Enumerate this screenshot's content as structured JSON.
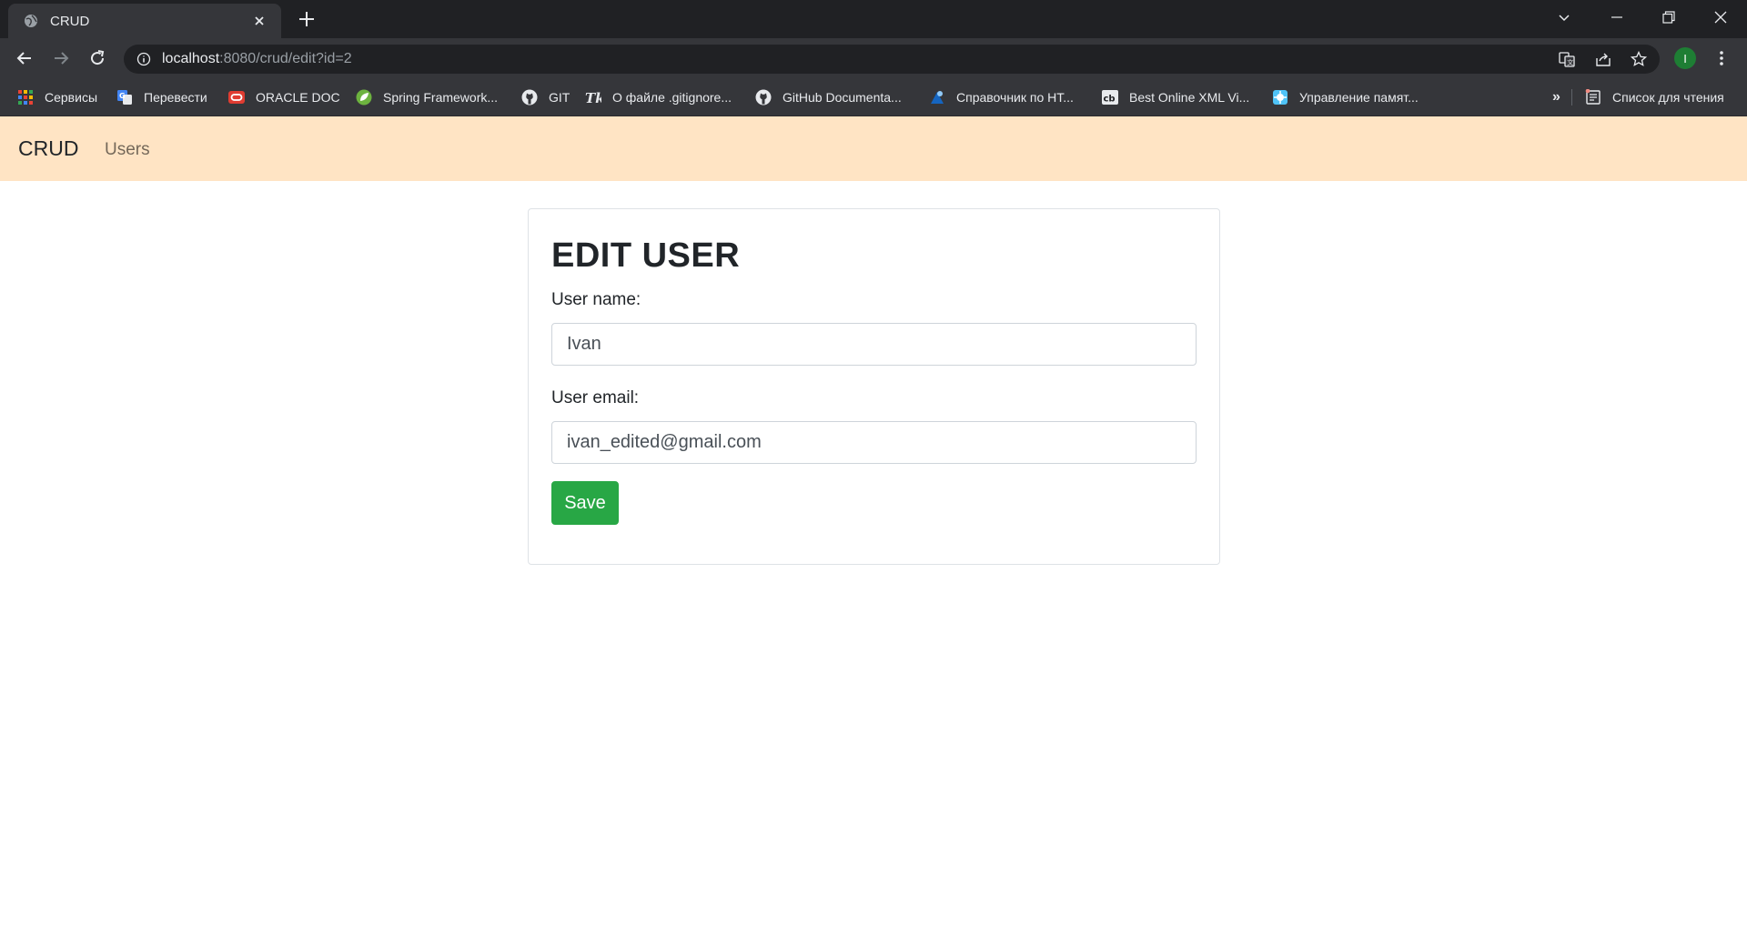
{
  "browser": {
    "tab_title": "CRUD",
    "url_host": "localhost",
    "url_rest": ":8080/crud/edit?id=2",
    "profile_initial": "I",
    "bookmarks": [
      {
        "label": "Сервисы",
        "icon": "apps-grid-icon"
      },
      {
        "label": "Перевести",
        "icon": "google-translate-icon"
      },
      {
        "label": "ORACLE DOC",
        "icon": "oracle-icon"
      },
      {
        "label": "Spring Framework...",
        "icon": "spring-leaf-icon"
      },
      {
        "label": "GIT",
        "icon": "github-icon"
      },
      {
        "label": "О файле .gitignore...",
        "icon": "tk-icon"
      },
      {
        "label": "GitHub Documenta...",
        "icon": "github-icon"
      },
      {
        "label": "Справочник по HT...",
        "icon": "html-ref-icon"
      },
      {
        "label": "Best Online XML Vi...",
        "icon": "cb-icon"
      },
      {
        "label": "Управление памят...",
        "icon": "memory-icon"
      }
    ],
    "more_bookmarks": "»",
    "reading_list": "Список для чтения"
  },
  "navbar": {
    "brand": "CRUD",
    "link_users": "Users",
    "background": "#ffe4c4"
  },
  "form": {
    "title": "EDIT USER",
    "name_label": "User name:",
    "name_value": "Ivan",
    "email_label": "User email:",
    "email_value": "ivan_edited@gmail.com",
    "save_label": "Save",
    "save_color": "#28a745"
  }
}
